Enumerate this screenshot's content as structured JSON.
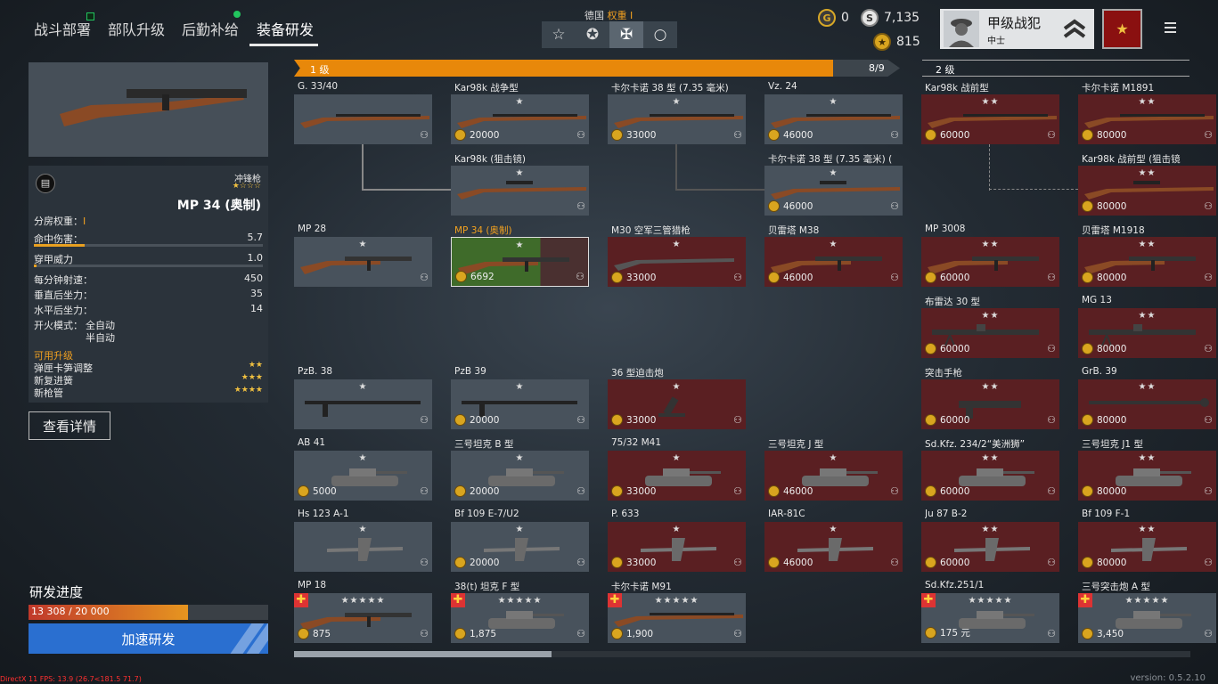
{
  "nav": {
    "tabs": [
      {
        "label": "战斗部署"
      },
      {
        "label": "部队升级"
      },
      {
        "label": "后勤补给"
      },
      {
        "label": "装备研发"
      }
    ]
  },
  "nation": {
    "label": "德国",
    "weight_label": "权重",
    "weight_value": "I"
  },
  "currency": {
    "gold": "0",
    "silver": "7,135",
    "coins": "815"
  },
  "profile": {
    "title": "甲级战犯",
    "rank": "中士"
  },
  "selected": {
    "type": "冲锋枪",
    "name": "MP 34 (奥制)",
    "weight_label": "分房权重：",
    "weight_value": "I",
    "stats": [
      {
        "label": "命中伤害：",
        "value": "5.7",
        "bar": 0.22
      },
      {
        "label": "穿甲威力",
        "value": "1.0",
        "bar": 0.01
      },
      {
        "label": "每分钟射速：",
        "value": "450"
      },
      {
        "label": "垂直后坐力：",
        "value": "35"
      },
      {
        "label": "水平后坐力：",
        "value": "14"
      }
    ],
    "fire_mode_label": "开火模式：",
    "fire_modes": [
      "全自动",
      "半自动"
    ],
    "upgrades_label": "可用升级",
    "upgrades": [
      {
        "name": "弹匣卡笋调整",
        "stars": "★★"
      },
      {
        "name": "新复进簧",
        "stars": "★★★"
      },
      {
        "name": "新枪管",
        "stars": "★★★★"
      }
    ],
    "detail_button": "查看详情"
  },
  "research": {
    "title": "研发进度",
    "text": "13 308 / 20 000",
    "fraction": 0.6654,
    "speed_button": "加速研发"
  },
  "tiers": [
    {
      "label": "1 级",
      "progress": "8/9",
      "fraction": 0.89
    },
    {
      "label": "2 级"
    }
  ],
  "cards": [
    {
      "name": "G. 33/40",
      "stars": "",
      "cost": "",
      "style": "grey",
      "icon": "rifle-icon",
      "basket": false
    },
    {
      "name": "Kar98k 战争型",
      "stars": "★",
      "cost": "20000",
      "style": "grey",
      "icon": "rifle-icon"
    },
    {
      "name": "卡尔卡诺 38 型 (7.35 毫米)",
      "stars": "★",
      "cost": "33000",
      "style": "grey",
      "icon": "rifle-icon"
    },
    {
      "name": "Vz. 24",
      "stars": "★",
      "cost": "46000",
      "style": "grey",
      "icon": "rifle-icon"
    },
    {
      "name": "Kar98k 战前型",
      "stars": "★★",
      "cost": "60000",
      "style": "red",
      "icon": "rifle-icon"
    },
    {
      "name": "卡尔卡诺 M1891",
      "stars": "★★",
      "cost": "80000",
      "style": "red",
      "icon": "rifle-icon"
    },
    {
      "name": "Kar98k (狙击镜)",
      "stars": "★",
      "cost": "",
      "style": "grey",
      "icon": "scope-icon"
    },
    {
      "name": "卡尔卡诺 38 型 (7.35 毫米) (",
      "stars": "★",
      "cost": "46000",
      "style": "grey",
      "icon": "scope-icon"
    },
    {
      "name": "Kar98k 战前型 (狙击镜",
      "stars": "★★",
      "cost": "80000",
      "style": "red",
      "icon": "scope-icon"
    },
    {
      "name": "MP 28",
      "stars": "★",
      "cost": "",
      "style": "grey",
      "icon": "smg-icon"
    },
    {
      "name": "MP 34 (奥制)",
      "stars": "★",
      "cost": "6692",
      "style": "sel",
      "icon": "smg-icon"
    },
    {
      "name": "M30 空军三管猎枪",
      "stars": "★",
      "cost": "33000",
      "style": "red",
      "icon": "shotgun-icon"
    },
    {
      "name": "贝雷塔 M38",
      "stars": "★",
      "cost": "46000",
      "style": "red",
      "icon": "smg-icon"
    },
    {
      "name": "MP 3008",
      "stars": "★★",
      "cost": "60000",
      "style": "red",
      "icon": "smg-icon"
    },
    {
      "name": "贝雷塔 M1918",
      "stars": "★★",
      "cost": "80000",
      "style": "red",
      "icon": "smg-icon"
    },
    {
      "name": "布雷达 30 型",
      "stars": "★★",
      "cost": "60000",
      "style": "red",
      "icon": "mg-icon"
    },
    {
      "name": "MG 13",
      "stars": "★★",
      "cost": "80000",
      "style": "red",
      "icon": "mg-icon"
    },
    {
      "name": "PzB. 38",
      "stars": "★",
      "cost": "",
      "style": "grey",
      "icon": "at-rifle-icon"
    },
    {
      "name": "PzB 39",
      "stars": "★",
      "cost": "20000",
      "style": "grey",
      "icon": "at-rifle-icon"
    },
    {
      "name": "36 型迫击炮",
      "stars": "★",
      "cost": "33000",
      "style": "red",
      "icon": "mortar-icon"
    },
    {
      "name": "突击手枪",
      "stars": "★★",
      "cost": "60000",
      "style": "red",
      "icon": "flare-icon"
    },
    {
      "name": "GrB. 39",
      "stars": "★★",
      "cost": "80000",
      "style": "red",
      "icon": "grenade-rifle-icon"
    },
    {
      "name": "AB 41",
      "stars": "★",
      "cost": "5000",
      "style": "grey",
      "icon": "tank-icon"
    },
    {
      "name": "三号坦克 B 型",
      "stars": "★",
      "cost": "20000",
      "style": "grey",
      "icon": "tank-icon"
    },
    {
      "name": "75/32 M41",
      "stars": "★",
      "cost": "33000",
      "style": "red",
      "icon": "tank-icon"
    },
    {
      "name": "三号坦克 J 型",
      "stars": "★",
      "cost": "46000",
      "style": "red",
      "icon": "tank-icon"
    },
    {
      "name": "Sd.Kfz. 234/2“美洲狮”",
      "stars": "★★",
      "cost": "60000",
      "style": "red",
      "icon": "tank-icon"
    },
    {
      "name": "三号坦克 J1 型",
      "stars": "★★",
      "cost": "80000",
      "style": "red",
      "icon": "tank-icon"
    },
    {
      "name": "Hs 123 A-1",
      "stars": "★",
      "cost": "",
      "style": "grey",
      "icon": "plane-icon"
    },
    {
      "name": "Bf 109 E-7/U2",
      "stars": "★",
      "cost": "20000",
      "style": "grey",
      "icon": "plane-icon"
    },
    {
      "name": "P. 633",
      "stars": "★",
      "cost": "33000",
      "style": "red",
      "icon": "plane-icon"
    },
    {
      "name": "IAR-81C",
      "stars": "★",
      "cost": "46000",
      "style": "red",
      "icon": "plane-icon"
    },
    {
      "name": "Ju 87 B-2",
      "stars": "★★",
      "cost": "60000",
      "style": "red",
      "icon": "plane-icon"
    },
    {
      "name": "Bf 109 F-1",
      "stars": "★★",
      "cost": "80000",
      "style": "red",
      "icon": "plane-icon"
    },
    {
      "name": "MP 18",
      "stars": "★★★★★",
      "cost": "875",
      "style": "grey",
      "icon": "smg-icon"
    },
    {
      "name": "38(t) 坦克 F 型",
      "stars": "★★★★★",
      "cost": "1,875",
      "style": "grey",
      "icon": "tank-icon"
    },
    {
      "name": "卡尔卡诺 M91",
      "stars": "★★★★★",
      "cost": "1,900",
      "style": "grey",
      "icon": "rifle-icon"
    },
    {
      "name": "Sd.Kfz.251/1",
      "stars": "★★★★★",
      "cost": "175 元",
      "style": "grey",
      "icon": "tank-icon"
    },
    {
      "name": "三号突击炮 A 型",
      "stars": "★★★★★",
      "cost": "3,450",
      "style": "grey",
      "icon": "tank-icon"
    }
  ],
  "debug": "DirectX 11 FPS: 13.9 (26.7<181.5 71.7)",
  "version": "version: 0.5.2.10"
}
